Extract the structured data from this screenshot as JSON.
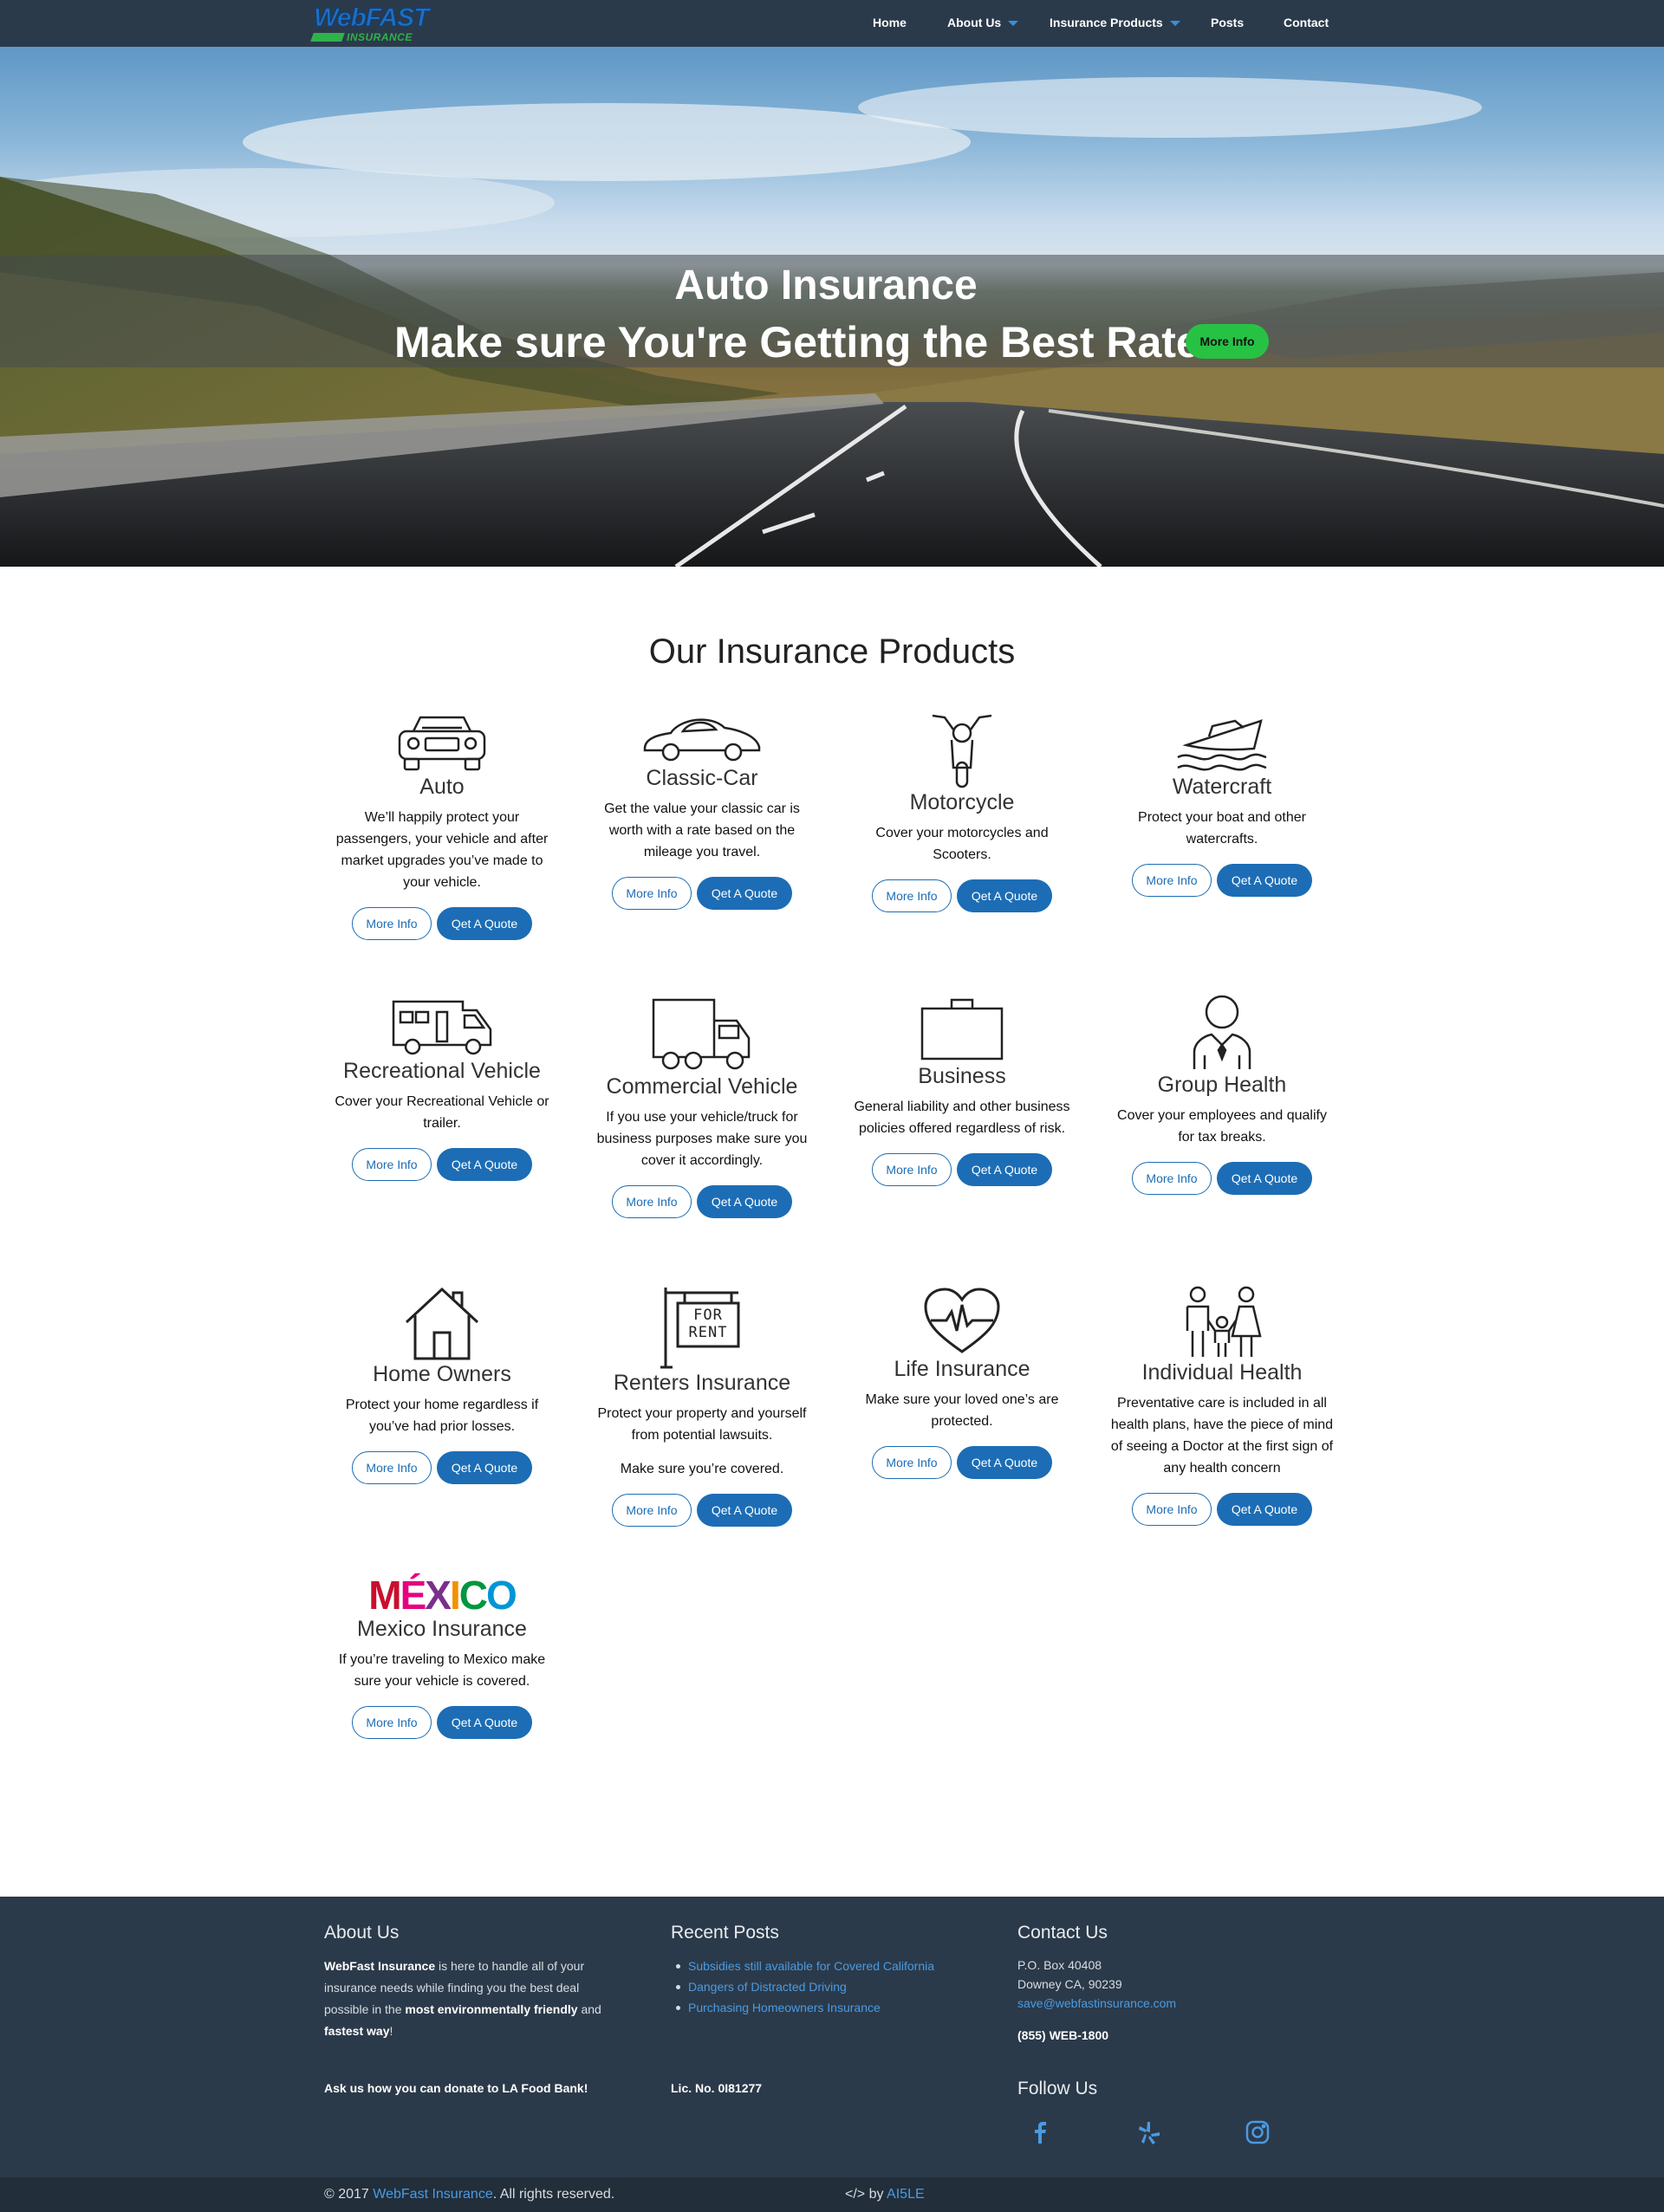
{
  "nav": {
    "logo_top": "WebFAST",
    "logo_bottom": "INSURANCE",
    "items": [
      "Home",
      "About Us",
      "Insurance Products",
      "Posts",
      "Contact"
    ]
  },
  "hero": {
    "title": "Auto Insurance",
    "subtitle": "Make sure You're Getting the Best Rate!",
    "button": "More Info"
  },
  "products_title": "Our Insurance Products",
  "buttons": {
    "more": "More Info",
    "quote": "Qet A Quote"
  },
  "products": [
    {
      "name": "Auto",
      "icon": "car-front-icon",
      "desc": "We’ll happily protect your passengers, your vehicle and after market upgrades you’ve made to your vehicle."
    },
    {
      "name": "Classic-Car",
      "icon": "classic-car-icon",
      "desc": "Get the value your classic car is worth with a rate based on the mileage you travel."
    },
    {
      "name": "Motorcycle",
      "icon": "motorcycle-icon",
      "desc": "Cover your motorcycles and Scooters."
    },
    {
      "name": "Watercraft",
      "icon": "boat-icon",
      "desc": "Protect your boat and other watercrafts."
    },
    {
      "name": "Recreational Vehicle",
      "icon": "rv-icon",
      "desc": "Cover your Recreational Vehicle or trailer."
    },
    {
      "name": "Commercial Vehicle",
      "icon": "truck-icon",
      "desc": "If you use your vehicle/truck for business purposes make sure you cover it accordingly."
    },
    {
      "name": "Business",
      "icon": "briefcase-icon",
      "desc": "General liability and other business policies offered regardless of risk."
    },
    {
      "name": "Group Health",
      "icon": "person-icon",
      "desc": "Cover your employees and qualify for tax breaks."
    },
    {
      "name": "Home Owners",
      "icon": "house-icon",
      "desc": "Protect your home regardless if you’ve had prior losses."
    },
    {
      "name": "Renters Insurance",
      "icon": "for-rent-sign-icon",
      "sign_text": "FOR RENT",
      "desc": "Protect your property and yourself from potential lawsuits.",
      "desc2": "Make sure you’re covered."
    },
    {
      "name": "Life Insurance",
      "icon": "heart-pulse-icon",
      "desc": "Make sure your loved one’s are protected."
    },
    {
      "name": "Individual Health",
      "icon": "family-icon",
      "desc": "Preventative care is included in all health plans, have the piece of mind of seeing a Doctor at the first sign of any health concern"
    },
    {
      "name": "Mexico Insurance",
      "icon": "mexico-logo-icon",
      "logo_text": "MÉXICO",
      "desc": "If you’re traveling to Mexico make sure your vehicle is covered."
    }
  ],
  "footer": {
    "about_title": "About Us",
    "about_brand": "WebFast Insurance",
    "about_text_1": " is here to handle all of your insurance needs while finding you the best deal possible  in the ",
    "about_bold_1": "most environmentally friendly",
    "about_text_2": " and ",
    "about_bold_2": "fastest way",
    "about_text_3": "!",
    "donate": "Ask us how you can donate to LA Food Bank!",
    "posts_title": "Recent Posts",
    "posts": [
      "Subsidies still available for Covered California",
      "Dangers of Distracted Driving",
      "Purchasing Homeowners Insurance"
    ],
    "license": "Lic. No. 0I81277",
    "contact_title": "Contact Us",
    "address_1": "P.O. Box 40408",
    "address_2": "Downey CA, 90239",
    "email": "save@webfastinsurance.com",
    "phone": "(855) WEB-1800",
    "follow_title": "Follow Us",
    "social": [
      "facebook-icon",
      "yelp-icon",
      "instagram-icon"
    ],
    "copyright_pre": "© 2017 ",
    "copyright_brand": "WebFast Insurance",
    "copyright_post": ". All rights reserved.",
    "credit_pre": "</> by ",
    "credit_brand": "AI5LE"
  },
  "colors": {
    "nav_bg": "#2b3a4a",
    "accent_blue": "#1c6db5",
    "hero_button": "#27c244",
    "link": "#4a9be3"
  }
}
